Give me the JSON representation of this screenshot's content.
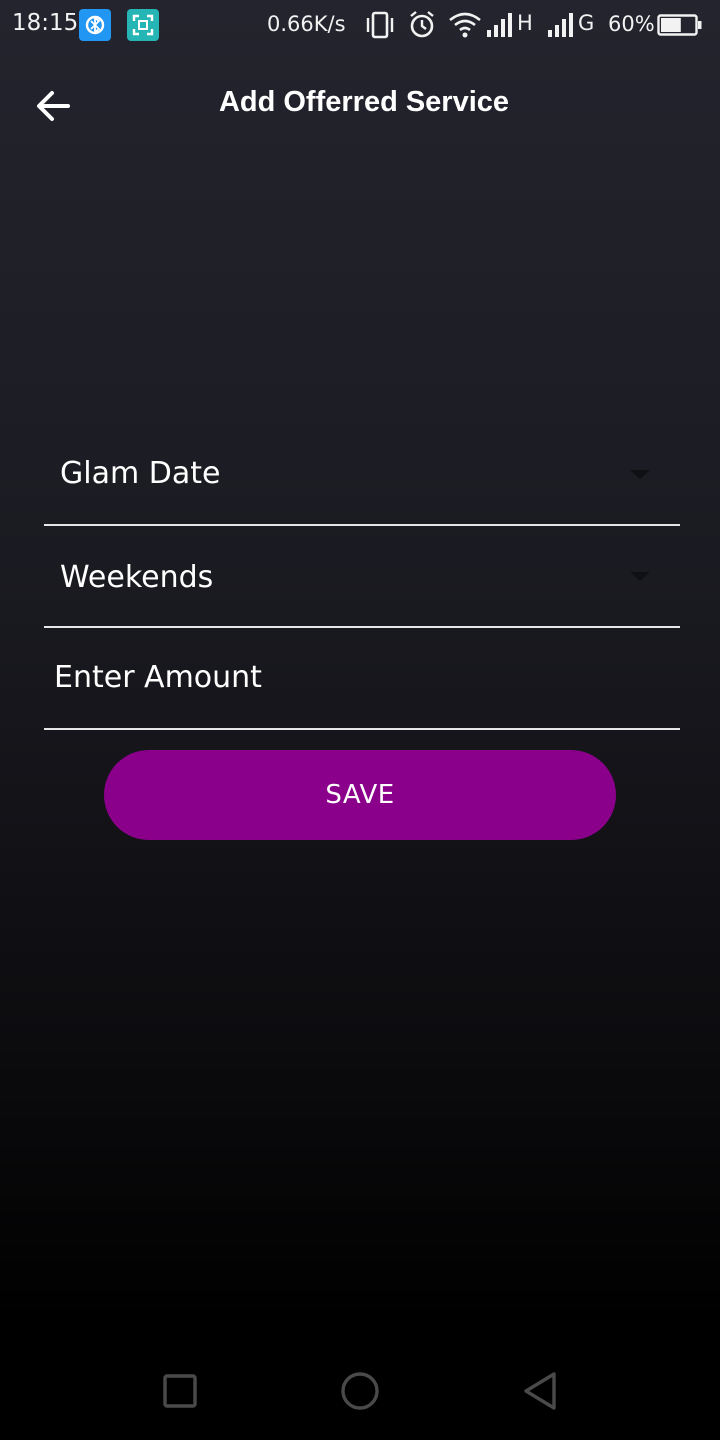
{
  "status_bar": {
    "time": "18:15",
    "net_speed": "0.66K/s",
    "signal1_label": "H",
    "signal2_label": "G",
    "battery": "60%",
    "battery_level": 0.6,
    "icons": [
      "app-bluetooth-icon",
      "app-scan-icon",
      "vibrate-icon",
      "alarm-icon",
      "wifi-icon",
      "signal-icon",
      "signal-icon",
      "battery-icon"
    ]
  },
  "header": {
    "title": "Add Offerred Service",
    "back_icon": "arrow-left-icon"
  },
  "form": {
    "service_select": {
      "value": "Glam Date",
      "icon": "dropdown-arrow-icon"
    },
    "schedule_select": {
      "value": "Weekends",
      "icon": "dropdown-arrow-icon"
    },
    "amount_input": {
      "placeholder": "Enter Amount",
      "value": ""
    },
    "save_label": "SAVE"
  },
  "nav_bar": {
    "icons": [
      "recent-apps-icon",
      "home-icon",
      "back-icon"
    ]
  },
  "colors": {
    "accent": "#8b008b",
    "background_top": "#24242e",
    "background_bottom": "#000000",
    "divider": "#e6e6e6"
  }
}
